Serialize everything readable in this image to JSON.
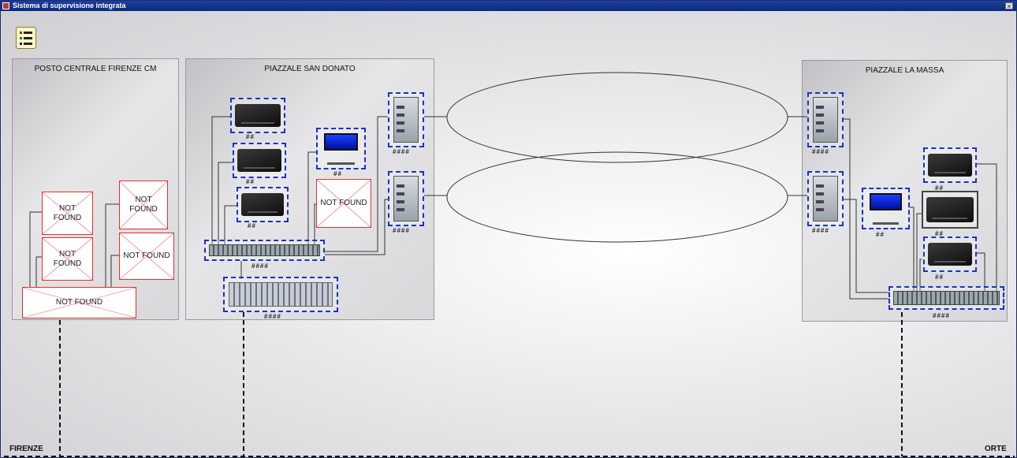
{
  "window": {
    "title": "Sistema di supervisione integrata",
    "close_glyph": "✕"
  },
  "toolbar": {
    "menu_icon": "list-icon"
  },
  "stations": {
    "firenze_cm": {
      "title": "POSTO CENTRALE FIRENZE CM"
    },
    "san_donato": {
      "title": "PIAZZALE SAN DONATO"
    },
    "la_massa": {
      "title": "PIAZZALE LA MASSA"
    }
  },
  "placeholders": {
    "nf1": "NOT\nFOUND",
    "nf2": "NOT\nFOUND",
    "nf3": "NOT\nFOUND",
    "nf4": "NOT FOUND",
    "nf5": "NOT FOUND",
    "nf6": "NOT FOUND"
  },
  "labels": {
    "short": "##",
    "long": "####"
  },
  "line_ends": {
    "left": "FIRENZE",
    "right": "ORTE"
  },
  "colors": {
    "title_bar": "#0b2a7e",
    "device_border": "#1c30c8",
    "missing_border": "#e03030"
  }
}
